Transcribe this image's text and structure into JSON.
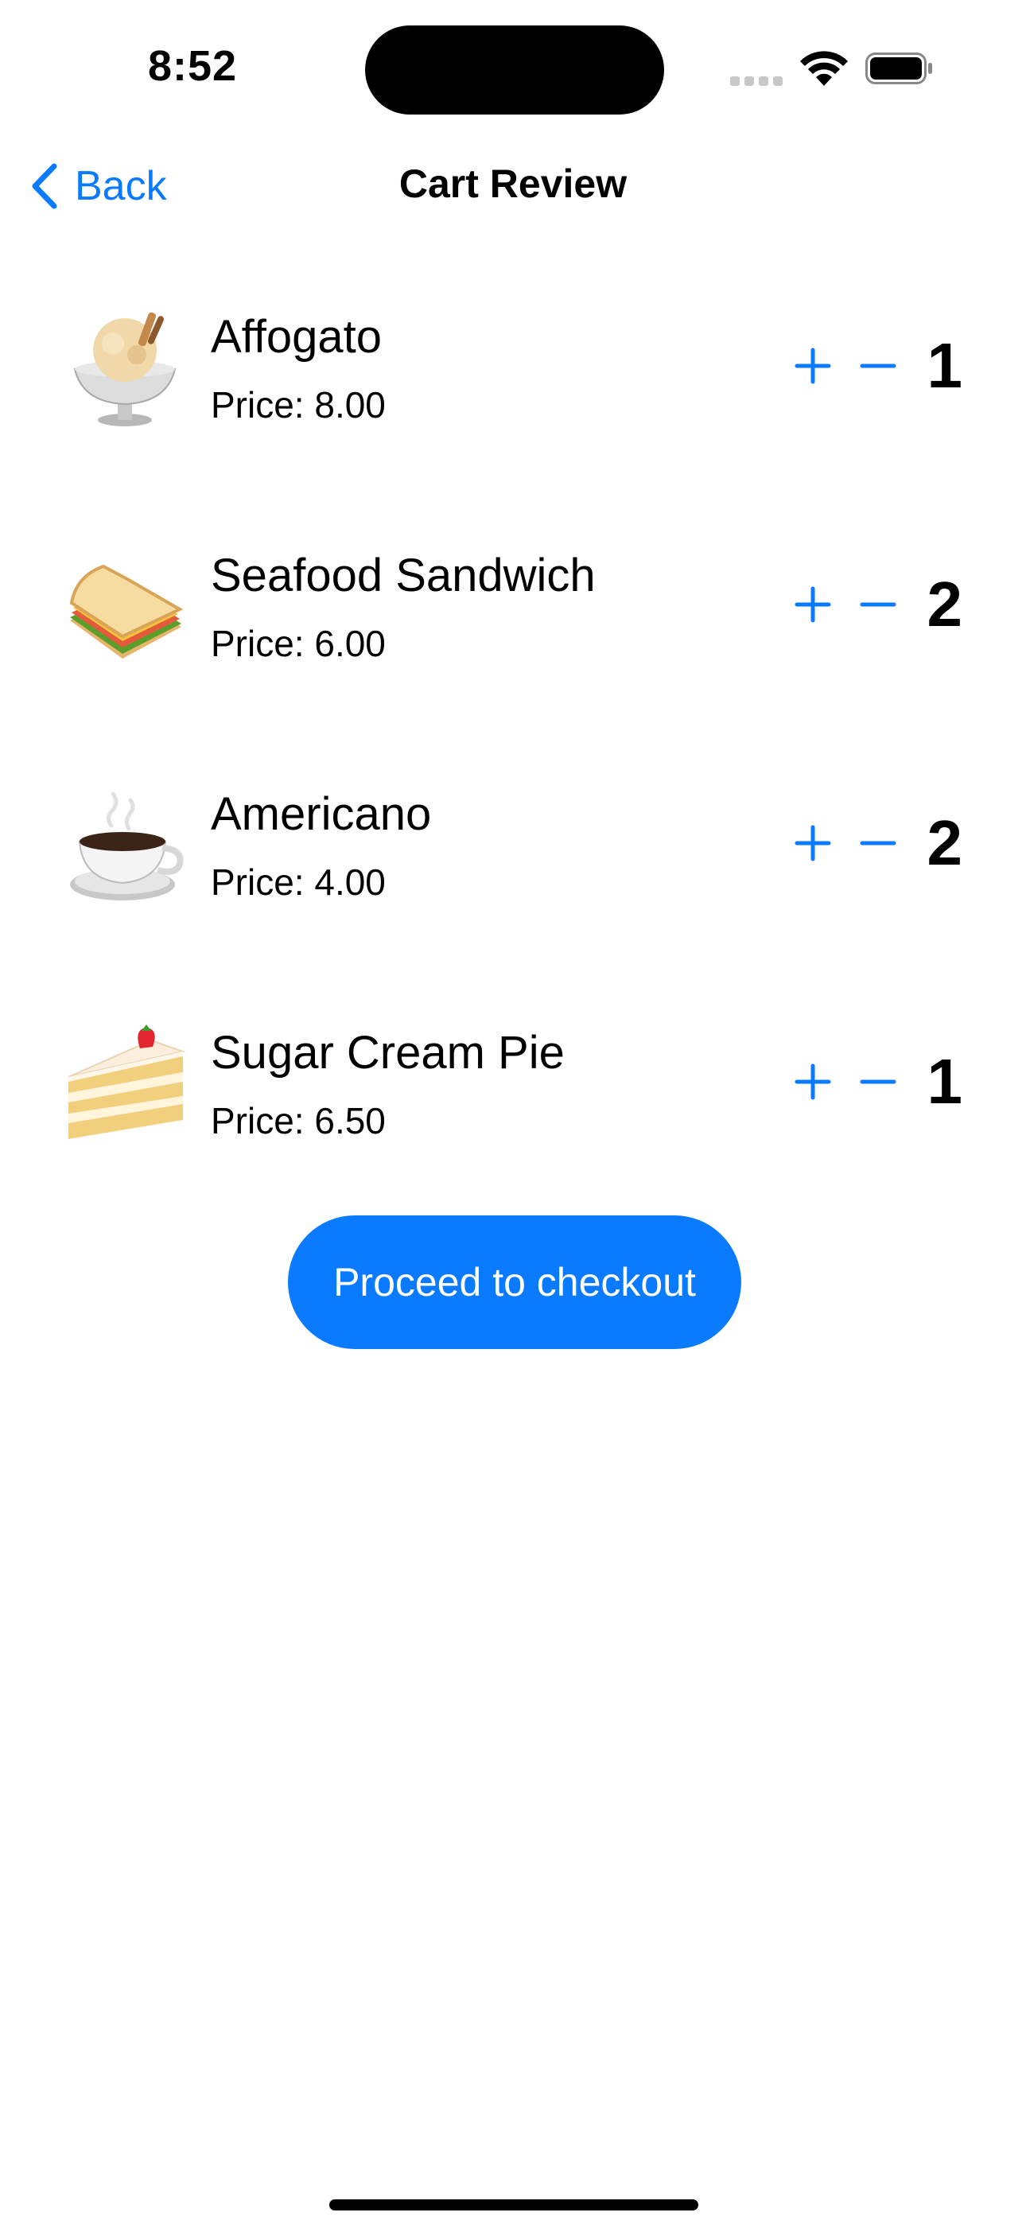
{
  "status_bar": {
    "time": "8:52"
  },
  "nav": {
    "back_label": "Back",
    "title": "Cart Review"
  },
  "cart": {
    "items": [
      {
        "name": "Affogato",
        "price": "Price: 8.00",
        "quantity": "1",
        "image": "affogato-icon"
      },
      {
        "name": "Seafood Sandwich",
        "price": "Price: 6.00",
        "quantity": "2",
        "image": "sandwich-icon"
      },
      {
        "name": "Americano",
        "price": "Price: 4.00",
        "quantity": "2",
        "image": "coffee-cup-icon"
      },
      {
        "name": "Sugar Cream Pie",
        "price": "Price: 6.50",
        "quantity": "1",
        "image": "cake-slice-icon"
      }
    ]
  },
  "checkout": {
    "label": "Proceed to checkout"
  },
  "colors": {
    "accent": "#0a7aff",
    "background": "#ffffff",
    "text": "#000000"
  }
}
